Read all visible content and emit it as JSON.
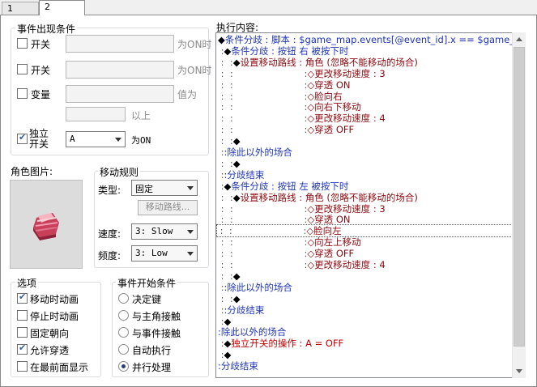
{
  "tabs": [
    {
      "label": "1"
    },
    {
      "label": "2"
    }
  ],
  "conditions": {
    "title": "事件出现条件",
    "switch1": {
      "label": "开关",
      "suffix": "为ON时"
    },
    "switch2": {
      "label": "开关",
      "suffix": "为ON时"
    },
    "variable": {
      "label": "变量",
      "suffix": "值为",
      "above": "以上"
    },
    "self_switch": {
      "label_line1": "独立",
      "label_line2": "开关",
      "value": "A",
      "suffix": "为ON"
    }
  },
  "graphic": {
    "title": "角色图片:"
  },
  "movement": {
    "title": "移动规则",
    "type_label": "类型:",
    "type_value": "固定",
    "route_button": "移动路线...",
    "speed_label": "速度:",
    "speed_value": "3: Slow",
    "freq_label": "频度:",
    "freq_value": "3: Low"
  },
  "options": {
    "title": "选项",
    "items": [
      {
        "label": "移动时动画",
        "checked": true
      },
      {
        "label": "停止时动画",
        "checked": false
      },
      {
        "label": "固定朝向",
        "checked": false
      },
      {
        "label": "允许穿透",
        "checked": true
      },
      {
        "label": "在最前面显示",
        "checked": false
      }
    ]
  },
  "trigger": {
    "title": "事件开始条件",
    "items": [
      {
        "label": "决定键",
        "selected": false
      },
      {
        "label": "与主角接触",
        "selected": false
      },
      {
        "label": "与事件接触",
        "selected": false
      },
      {
        "label": "自动执行",
        "selected": false
      },
      {
        "label": "并行处理",
        "selected": true
      }
    ]
  },
  "contents": {
    "title": "执行内容:",
    "lines": [
      {
        "indent": "",
        "mark": "◆",
        "text": "条件分歧 : 脚本 : $game_map.events[@event_id].x == $game_p",
        "color": "#1f35b5"
      },
      {
        "indent": " :",
        "mark": "◆",
        "text": "条件分歧 : 按钮 右 被按下时",
        "color": "#1f35b5"
      },
      {
        "indent": " :  :",
        "mark": "◆",
        "text": "设置移动路线 : 角色 (忽略不能移动的场合)",
        "color": "#8a0a10"
      },
      {
        "indent": " :  :                        :",
        "mark": "",
        "text": "◇更改移动速度 : 3",
        "color": "#8a0a10"
      },
      {
        "indent": " :  :                        :",
        "mark": "",
        "text": "◇穿透 ON",
        "color": "#8a0a10"
      },
      {
        "indent": " :  :                        :",
        "mark": "",
        "text": "◇脸向右",
        "color": "#8a0a10"
      },
      {
        "indent": " :  :                        :",
        "mark": "",
        "text": "◇向右下移动",
        "color": "#8a0a10"
      },
      {
        "indent": " :  :                        :",
        "mark": "",
        "text": "◇更改移动速度 : 4",
        "color": "#8a0a10"
      },
      {
        "indent": " :  :                        :",
        "mark": "",
        "text": "◇穿透 OFF",
        "color": "#8a0a10"
      },
      {
        "indent": " :  :",
        "mark": "◆",
        "text": "",
        "color": "#000000"
      },
      {
        "indent": " :",
        "mark": "",
        "text": ":除此以外的场合",
        "color": "#1f35b5"
      },
      {
        "indent": " :  :",
        "mark": "◆",
        "text": "",
        "color": "#000000"
      },
      {
        "indent": " :",
        "mark": "",
        "text": ":分歧结束",
        "color": "#1f35b5"
      },
      {
        "indent": " :",
        "mark": "◆",
        "text": "条件分歧 : 按钮 左 被按下时",
        "color": "#1f35b5"
      },
      {
        "indent": " :  :",
        "mark": "◆",
        "text": "设置移动路线 : 角色 (忽略不能移动的场合)",
        "color": "#8a0a10"
      },
      {
        "indent": " :  :                        :",
        "mark": "",
        "text": "◇更改移动速度 : 3",
        "color": "#8a0a10"
      },
      {
        "indent": " :  :                        :",
        "mark": "",
        "text": "◇穿透 ON",
        "color": "#8a0a10"
      },
      {
        "indent": " :  :                        :",
        "mark": "",
        "text": "◇脸向左",
        "color": "#8a0a10"
      },
      {
        "indent": " :  :                        :",
        "mark": "",
        "text": "◇向左上移动",
        "color": "#8a0a10"
      },
      {
        "indent": " :  :                        :",
        "mark": "",
        "text": "◇穿透 OFF",
        "color": "#8a0a10"
      },
      {
        "indent": " :  :                        :",
        "mark": "",
        "text": "◇更改移动速度 : 4",
        "color": "#8a0a10"
      },
      {
        "indent": " :  :",
        "mark": "◆",
        "text": "",
        "color": "#000000"
      },
      {
        "indent": " :",
        "mark": "",
        "text": ":除此以外的场合",
        "color": "#1f35b5"
      },
      {
        "indent": " :  :",
        "mark": "◆",
        "text": "",
        "color": "#000000"
      },
      {
        "indent": " :",
        "mark": "",
        "text": ":分歧结束",
        "color": "#1f35b5"
      },
      {
        "indent": " :",
        "mark": "◆",
        "text": "",
        "color": "#000000"
      },
      {
        "indent": "",
        "mark": "",
        "text": ":除此以外的场合",
        "color": "#1f35b5"
      },
      {
        "indent": " :",
        "mark": "◆",
        "text": "独立开关的操作 : A = OFF",
        "color": "#c00000"
      },
      {
        "indent": " :",
        "mark": "◆",
        "text": "",
        "color": "#000000"
      },
      {
        "indent": "",
        "mark": "",
        "text": ":分歧结束",
        "color": "#1f35b5"
      }
    ]
  }
}
